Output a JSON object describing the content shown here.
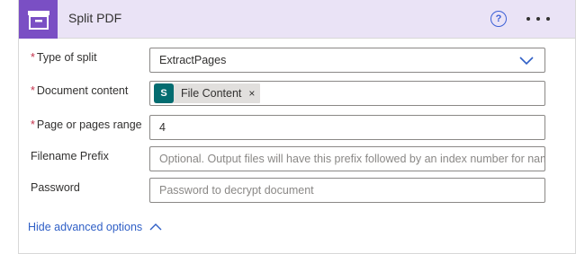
{
  "header": {
    "title": "Split PDF",
    "help_label": "?"
  },
  "fields": {
    "type_of_split": {
      "required_mark": "*",
      "label": "Type of split",
      "value": "ExtractPages"
    },
    "document_content": {
      "required_mark": "*",
      "label": "Document content",
      "token_label": "File Content",
      "token_icon_text": "S",
      "remove_label": "×"
    },
    "page_range": {
      "required_mark": "*",
      "label": "Page or pages range",
      "value": "4"
    },
    "filename_prefix": {
      "label": "Filename Prefix",
      "placeholder": "Optional. Output files will have this prefix followed by an index number for naming"
    },
    "password": {
      "label": "Password",
      "placeholder": "Password to decrypt document"
    }
  },
  "advanced": {
    "label": "Hide advanced options"
  },
  "colors": {
    "header_bg": "#eae3f6",
    "app_icon_bg": "#7a4fc4",
    "link": "#2f5fc6",
    "required": "#c4314b",
    "sharepoint": "#036c70"
  },
  "icons": {
    "app": "pdf-splitter-icon",
    "help": "help-circle-icon",
    "more": "ellipsis-icon",
    "dropdown": "chevron-down-icon",
    "token": "sharepoint-icon",
    "collapse": "chevron-up-icon"
  }
}
